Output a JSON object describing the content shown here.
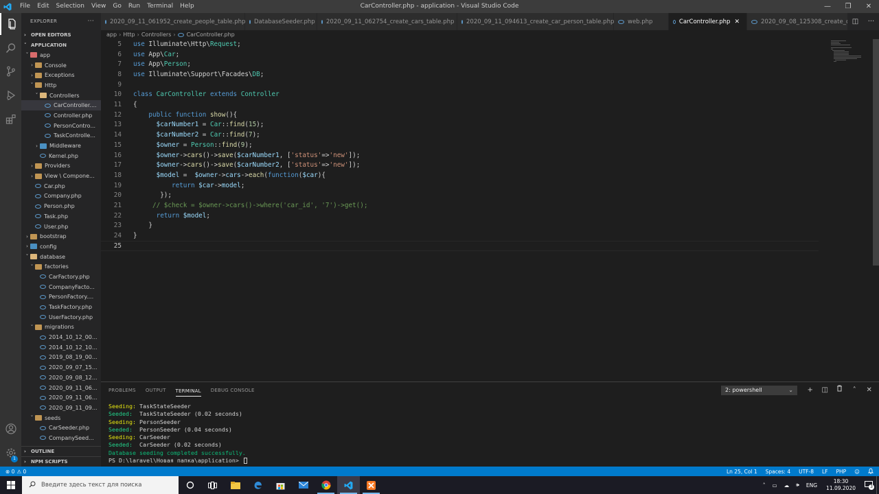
{
  "window": {
    "title": "CarController.php - application - Visual Studio Code",
    "menu": [
      "File",
      "Edit",
      "Selection",
      "View",
      "Go",
      "Run",
      "Terminal",
      "Help"
    ],
    "controls": [
      "—",
      "❐",
      "✕"
    ]
  },
  "sidebar": {
    "header": "EXPLORER",
    "more": "···",
    "open_editors": "OPEN EDITORS",
    "project": "APPLICATION",
    "tree": [
      {
        "label": "app",
        "depth": 1,
        "type": "folder-red",
        "chev": "˅"
      },
      {
        "label": "Console",
        "depth": 2,
        "type": "folder",
        "chev": "›"
      },
      {
        "label": "Exceptions",
        "depth": 2,
        "type": "folder",
        "chev": "›"
      },
      {
        "label": "Http",
        "depth": 2,
        "type": "folder",
        "chev": "˅"
      },
      {
        "label": "Controllers",
        "depth": 3,
        "type": "folder-open",
        "chev": "˅"
      },
      {
        "label": "CarController....",
        "depth": 4,
        "type": "php",
        "chev": "",
        "selected": true
      },
      {
        "label": "Controller.php",
        "depth": 4,
        "type": "php",
        "chev": ""
      },
      {
        "label": "PersonContro...",
        "depth": 4,
        "type": "php",
        "chev": ""
      },
      {
        "label": "TaskControlle...",
        "depth": 4,
        "type": "php",
        "chev": ""
      },
      {
        "label": "Middleware",
        "depth": 3,
        "type": "folder-blue",
        "chev": "›"
      },
      {
        "label": "Kernel.php",
        "depth": 3,
        "type": "php",
        "chev": ""
      },
      {
        "label": "Providers",
        "depth": 2,
        "type": "folder",
        "chev": "›"
      },
      {
        "label": "View \\ Compone...",
        "depth": 2,
        "type": "folder",
        "chev": "›"
      },
      {
        "label": "Car.php",
        "depth": 2,
        "type": "php",
        "chev": ""
      },
      {
        "label": "Company.php",
        "depth": 2,
        "type": "php",
        "chev": ""
      },
      {
        "label": "Person.php",
        "depth": 2,
        "type": "php",
        "chev": ""
      },
      {
        "label": "Task.php",
        "depth": 2,
        "type": "php",
        "chev": ""
      },
      {
        "label": "User.php",
        "depth": 2,
        "type": "php",
        "chev": ""
      },
      {
        "label": "bootstrap",
        "depth": 1,
        "type": "folder",
        "chev": "›"
      },
      {
        "label": "config",
        "depth": 1,
        "type": "folder-blue",
        "chev": "›"
      },
      {
        "label": "database",
        "depth": 1,
        "type": "folder-open",
        "chev": "˅"
      },
      {
        "label": "factories",
        "depth": 2,
        "type": "folder",
        "chev": "˅"
      },
      {
        "label": "CarFactory.php",
        "depth": 3,
        "type": "php",
        "chev": ""
      },
      {
        "label": "CompanyFacto...",
        "depth": 3,
        "type": "php",
        "chev": ""
      },
      {
        "label": "PersonFactory....",
        "depth": 3,
        "type": "php",
        "chev": ""
      },
      {
        "label": "TaskFactory.php",
        "depth": 3,
        "type": "php",
        "chev": ""
      },
      {
        "label": "UserFactory.php",
        "depth": 3,
        "type": "php",
        "chev": ""
      },
      {
        "label": "migrations",
        "depth": 2,
        "type": "folder",
        "chev": "˅"
      },
      {
        "label": "2014_10_12_00...",
        "depth": 3,
        "type": "php",
        "chev": ""
      },
      {
        "label": "2014_10_12_10...",
        "depth": 3,
        "type": "php",
        "chev": ""
      },
      {
        "label": "2019_08_19_00...",
        "depth": 3,
        "type": "php",
        "chev": ""
      },
      {
        "label": "2020_09_07_15...",
        "depth": 3,
        "type": "php",
        "chev": ""
      },
      {
        "label": "2020_09_08_12...",
        "depth": 3,
        "type": "php",
        "chev": ""
      },
      {
        "label": "2020_09_11_06...",
        "depth": 3,
        "type": "php",
        "chev": ""
      },
      {
        "label": "2020_09_11_06...",
        "depth": 3,
        "type": "php",
        "chev": ""
      },
      {
        "label": "2020_09_11_09...",
        "depth": 3,
        "type": "php",
        "chev": ""
      },
      {
        "label": "seeds",
        "depth": 2,
        "type": "folder",
        "chev": "˅"
      },
      {
        "label": "CarSeeder.php",
        "depth": 3,
        "type": "php",
        "chev": ""
      },
      {
        "label": "CompanySeed...",
        "depth": 3,
        "type": "php",
        "chev": ""
      }
    ],
    "outline": "OUTLINE",
    "npm_scripts": "NPM SCRIPTS"
  },
  "tabs": [
    {
      "label": "2020_09_11_061952_create_people_table.php",
      "active": false
    },
    {
      "label": "DatabaseSeeder.php",
      "active": false
    },
    {
      "label": "2020_09_11_062754_create_cars_table.php",
      "active": false
    },
    {
      "label": "2020_09_11_094613_create_car_person_table.php",
      "active": false
    },
    {
      "label": "web.php",
      "active": false
    },
    {
      "label": "CarController.php",
      "active": true
    },
    {
      "label": "2020_09_08_125308_create_o",
      "active": false
    }
  ],
  "tab_close": "✕",
  "breadcrumb": [
    "app",
    "Http",
    "Controllers",
    "CarController.php"
  ],
  "editor": {
    "lines": [
      {
        "n": "5",
        "tokens": [
          [
            "kw",
            "use "
          ],
          [
            "plain",
            "Illuminate\\Http\\"
          ],
          [
            "cls",
            "Request"
          ],
          [
            "plain",
            ";"
          ]
        ]
      },
      {
        "n": "6",
        "tokens": [
          [
            "kw",
            "use "
          ],
          [
            "plain",
            "App\\"
          ],
          [
            "cls",
            "Car"
          ],
          [
            "plain",
            ";"
          ]
        ]
      },
      {
        "n": "7",
        "tokens": [
          [
            "kw",
            "use "
          ],
          [
            "plain",
            "App\\"
          ],
          [
            "cls",
            "Person"
          ],
          [
            "plain",
            ";"
          ]
        ]
      },
      {
        "n": "8",
        "tokens": [
          [
            "kw",
            "use "
          ],
          [
            "plain",
            "Illuminate\\Support\\Facades\\"
          ],
          [
            "cls",
            "DB"
          ],
          [
            "plain",
            ";"
          ]
        ]
      },
      {
        "n": "9",
        "tokens": []
      },
      {
        "n": "10",
        "tokens": [
          [
            "kw",
            "class "
          ],
          [
            "cls",
            "CarController "
          ],
          [
            "kw",
            "extends "
          ],
          [
            "cls",
            "Controller"
          ]
        ]
      },
      {
        "n": "11",
        "tokens": [
          [
            "plain",
            "{"
          ]
        ]
      },
      {
        "n": "12",
        "tokens": [
          [
            "plain",
            "    "
          ],
          [
            "kw",
            "public function "
          ],
          [
            "fn",
            "show"
          ],
          [
            "plain",
            "(){"
          ]
        ]
      },
      {
        "n": "13",
        "tokens": [
          [
            "plain",
            "      "
          ],
          [
            "var",
            "$carNumber1"
          ],
          [
            "plain",
            " = "
          ],
          [
            "cls",
            "Car"
          ],
          [
            "plain",
            "::"
          ],
          [
            "fn",
            "find"
          ],
          [
            "plain",
            "("
          ],
          [
            "num",
            "15"
          ],
          [
            "plain",
            ");"
          ]
        ]
      },
      {
        "n": "14",
        "tokens": [
          [
            "plain",
            "      "
          ],
          [
            "var",
            "$carNumber2"
          ],
          [
            "plain",
            " = "
          ],
          [
            "cls",
            "Car"
          ],
          [
            "plain",
            "::"
          ],
          [
            "fn",
            "find"
          ],
          [
            "plain",
            "("
          ],
          [
            "num",
            "7"
          ],
          [
            "plain",
            ");"
          ]
        ]
      },
      {
        "n": "15",
        "tokens": [
          [
            "plain",
            "      "
          ],
          [
            "var",
            "$owner"
          ],
          [
            "plain",
            " = "
          ],
          [
            "cls",
            "Person"
          ],
          [
            "plain",
            "::"
          ],
          [
            "fn",
            "find"
          ],
          [
            "plain",
            "("
          ],
          [
            "num",
            "9"
          ],
          [
            "plain",
            ");"
          ]
        ]
      },
      {
        "n": "16",
        "tokens": [
          [
            "plain",
            "      "
          ],
          [
            "var",
            "$owner"
          ],
          [
            "plain",
            "->"
          ],
          [
            "fn",
            "cars"
          ],
          [
            "plain",
            "()->"
          ],
          [
            "fn",
            "save"
          ],
          [
            "plain",
            "("
          ],
          [
            "var",
            "$carNumber1"
          ],
          [
            "plain",
            ", ["
          ],
          [
            "str",
            "'status'"
          ],
          [
            "plain",
            "=>"
          ],
          [
            "str",
            "'new'"
          ],
          [
            "plain",
            "]);"
          ]
        ]
      },
      {
        "n": "17",
        "tokens": [
          [
            "plain",
            "      "
          ],
          [
            "var",
            "$owner"
          ],
          [
            "plain",
            "->"
          ],
          [
            "fn",
            "cars"
          ],
          [
            "plain",
            "()->"
          ],
          [
            "fn",
            "save"
          ],
          [
            "plain",
            "("
          ],
          [
            "var",
            "$carNumber2"
          ],
          [
            "plain",
            ", ["
          ],
          [
            "str",
            "'status'"
          ],
          [
            "plain",
            "=>"
          ],
          [
            "str",
            "'new'"
          ],
          [
            "plain",
            "]);"
          ]
        ]
      },
      {
        "n": "18",
        "tokens": [
          [
            "plain",
            "      "
          ],
          [
            "var",
            "$model"
          ],
          [
            "plain",
            " =  "
          ],
          [
            "var",
            "$owner"
          ],
          [
            "plain",
            "->"
          ],
          [
            "var",
            "cars"
          ],
          [
            "plain",
            "->"
          ],
          [
            "fn",
            "each"
          ],
          [
            "plain",
            "("
          ],
          [
            "kw",
            "function"
          ],
          [
            "plain",
            "("
          ],
          [
            "var",
            "$car"
          ],
          [
            "plain",
            "){"
          ]
        ]
      },
      {
        "n": "19",
        "tokens": [
          [
            "plain",
            "          "
          ],
          [
            "kw",
            "return "
          ],
          [
            "var",
            "$car"
          ],
          [
            "plain",
            "->"
          ],
          [
            "var",
            "model"
          ],
          [
            "plain",
            ";"
          ]
        ]
      },
      {
        "n": "20",
        "tokens": [
          [
            "plain",
            "       "
          ],
          [
            "plain",
            "});"
          ]
        ]
      },
      {
        "n": "21",
        "tokens": [
          [
            "plain",
            "     "
          ],
          [
            "com",
            "// $check = $owner->cars()->where('car_id', '7')->get();"
          ]
        ]
      },
      {
        "n": "22",
        "tokens": [
          [
            "plain",
            "      "
          ],
          [
            "kw",
            "return "
          ],
          [
            "var",
            "$model"
          ],
          [
            "plain",
            ";"
          ]
        ]
      },
      {
        "n": "23",
        "tokens": [
          [
            "plain",
            "    "
          ],
          [
            "plain",
            "}"
          ]
        ]
      },
      {
        "n": "24",
        "tokens": [
          [
            "plain",
            "}"
          ]
        ]
      },
      {
        "n": "25",
        "tokens": [],
        "current": true
      }
    ]
  },
  "panel": {
    "tabs": [
      "PROBLEMS",
      "OUTPUT",
      "TERMINAL",
      "DEBUG CONSOLE"
    ],
    "active_tab": "TERMINAL",
    "terminal_select": "2: powershell",
    "actions": [
      "+",
      "◫",
      "🗑",
      "˄",
      "✕"
    ],
    "terminal_lines": [
      [
        [
          "yel",
          "Seeding:"
        ],
        [
          "plain",
          " TaskStateSeeder"
        ]
      ],
      [
        [
          "grn",
          "Seeded: "
        ],
        [
          "plain",
          " TaskStateSeeder (0.02 seconds)"
        ]
      ],
      [
        [
          "yel",
          "Seeding:"
        ],
        [
          "plain",
          " PersonSeeder"
        ]
      ],
      [
        [
          "grn",
          "Seeded: "
        ],
        [
          "plain",
          " PersonSeeder (0.04 seconds)"
        ]
      ],
      [
        [
          "yel",
          "Seeding:"
        ],
        [
          "plain",
          " CarSeeder"
        ]
      ],
      [
        [
          "grn",
          "Seeded: "
        ],
        [
          "plain",
          " CarSeeder (0.02 seconds)"
        ]
      ],
      [
        [
          "grn2",
          "Database seeding completed successfully."
        ]
      ],
      [
        [
          "plain",
          "PS D:\\laravel\\Новая папка\\application> "
        ]
      ]
    ]
  },
  "statusbar": {
    "errors": "⊗ 0",
    "warnings": "⚠ 0",
    "position": "Ln 25, Col 1",
    "spaces": "Spaces: 4",
    "encoding": "UTF-8",
    "eol": "LF",
    "language": "PHP",
    "feedback": "☺",
    "bell": "🔔"
  },
  "taskbar": {
    "search_placeholder": "Введите здесь текст для поиска",
    "lang": "ENG",
    "time": "18:30",
    "date": "11.09.2020",
    "notifications": "3"
  },
  "colors": {
    "accent": "#007acc",
    "titlebar": "#3c3c3c",
    "sidebar": "#252526",
    "editor": "#1e1e1e"
  }
}
